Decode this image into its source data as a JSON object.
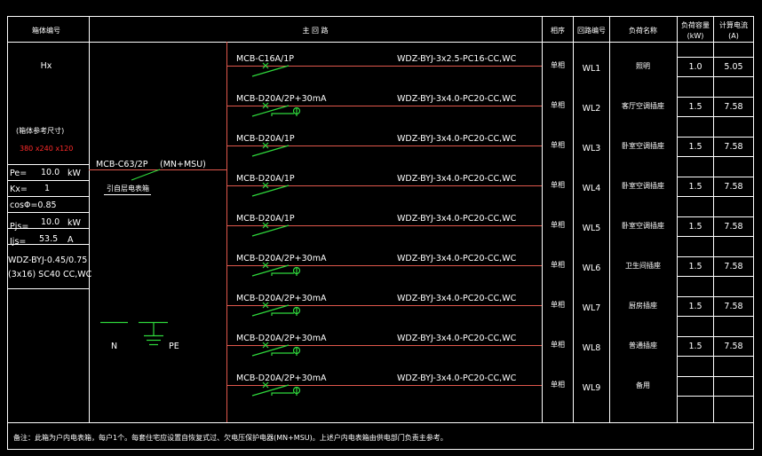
{
  "header": {
    "box_number": "箱体编号",
    "main_circuit": "主 回 路",
    "phase": "相序",
    "circuit_number": "回路编号",
    "load_name": "负荷名称",
    "load_capacity": "负荷容量",
    "load_capacity_unit": "(kW)",
    "calc_current": "计算电流",
    "calc_current_unit": "(A)"
  },
  "left": {
    "box_id": "Hx",
    "ref_size_label": "(箱体参考尺寸)",
    "ref_size_value": "380 x240 x120",
    "pe_label": "Pe=",
    "pe_value": "10.0",
    "pe_unit": "kW",
    "kx_label": "Kx=",
    "kx_value": "1",
    "cos_phi": "cosΦ=0.85",
    "pjs_label": "Pjs=",
    "pjs_value": "10.0",
    "pjs_unit": "kW",
    "ijs_label": "Ijs=",
    "ijs_value": "53.5",
    "ijs_unit": "A",
    "cable_line1": "WDZ-BYJ-0.45/0.75",
    "cable_line2": "(3x16) SC40 CC,WC"
  },
  "incoming": {
    "mcb_label": "MCB-C63/2P",
    "mcb_accessory": "(MN+MSU)",
    "note": "引自层电表箱"
  },
  "terminals": {
    "n": "N",
    "pe": "PE"
  },
  "circuits": [
    {
      "breaker": "MCB-C16A/1P",
      "rcd": false,
      "cable": "WDZ-BYJ-3x2.5-PC16-CC,WC",
      "phase": "单相",
      "id": "WL1",
      "load": "照明",
      "kw": "1.0",
      "amps": "5.05"
    },
    {
      "breaker": "MCB-D20A/2P+30mA",
      "rcd": true,
      "cable": "WDZ-BYJ-3x4.0-PC20-CC,WC",
      "phase": "单相",
      "id": "WL2",
      "load": "客厅空调插座",
      "kw": "1.5",
      "amps": "7.58"
    },
    {
      "breaker": "MCB-D20A/1P",
      "rcd": false,
      "cable": "WDZ-BYJ-3x4.0-PC20-CC,WC",
      "phase": "单相",
      "id": "WL3",
      "load": "卧室空调插座",
      "kw": "1.5",
      "amps": "7.58"
    },
    {
      "breaker": "MCB-D20A/1P",
      "rcd": false,
      "cable": "WDZ-BYJ-3x4.0-PC20-CC,WC",
      "phase": "单相",
      "id": "WL4",
      "load": "卧室空调插座",
      "kw": "1.5",
      "amps": "7.58"
    },
    {
      "breaker": "MCB-D20A/1P",
      "rcd": false,
      "cable": "WDZ-BYJ-3x4.0-PC20-CC,WC",
      "phase": "单相",
      "id": "WL5",
      "load": "卧室空调插座",
      "kw": "1.5",
      "amps": "7.58"
    },
    {
      "breaker": "MCB-D20A/2P+30mA",
      "rcd": true,
      "cable": "WDZ-BYJ-3x4.0-PC20-CC,WC",
      "phase": "单相",
      "id": "WL6",
      "load": "卫生间插座",
      "kw": "1.5",
      "amps": "7.58"
    },
    {
      "breaker": "MCB-D20A/2P+30mA",
      "rcd": true,
      "cable": "WDZ-BYJ-3x4.0-PC20-CC,WC",
      "phase": "单相",
      "id": "WL7",
      "load": "厨房插座",
      "kw": "1.5",
      "amps": "7.58"
    },
    {
      "breaker": "MCB-D20A/2P+30mA",
      "rcd": true,
      "cable": "WDZ-BYJ-3x4.0-PC20-CC,WC",
      "phase": "单相",
      "id": "WL8",
      "load": "普通插座",
      "kw": "1.5",
      "amps": "7.58"
    },
    {
      "breaker": "MCB-D20A/2P+30mA",
      "rcd": true,
      "cable": "WDZ-BYJ-3x4.0-PC20-CC,WC",
      "phase": "单相",
      "id": "WL9",
      "load": "备用",
      "kw": "",
      "amps": ""
    }
  ],
  "footer": {
    "note": "备注：此箱为户内电表箱，每户1个。每套住宅应设置自恢复式过、欠电压保护电器(MN+MSU)。上述户内电表箱由供电部门负责主参考。"
  }
}
